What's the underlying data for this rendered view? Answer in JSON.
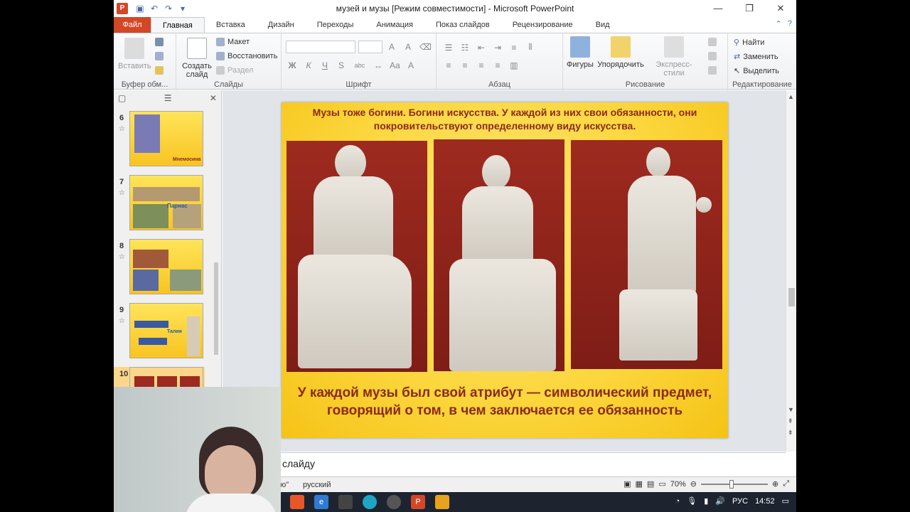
{
  "window": {
    "title": "музей и музы [Режим совместимости]  -  Microsoft PowerPoint",
    "app_icon": "P",
    "controls": [
      "minimize-icon",
      "restore-icon",
      "close-icon"
    ]
  },
  "tabs": [
    "Файл",
    "Главная",
    "Вставка",
    "Дизайн",
    "Переходы",
    "Анимация",
    "Показ слайдов",
    "Рецензирование",
    "Вид"
  ],
  "active_tab": "Главная",
  "ribbon": {
    "clipboard": {
      "paste": "Вставить",
      "label": "Буфер обм..."
    },
    "slides": {
      "new_slide": "Создать слайд",
      "layout": "Макет",
      "reset": "Восстановить",
      "section": "Раздел",
      "label": "Слайды"
    },
    "font": {
      "label": "Шрифт",
      "bold": "Ж",
      "italic": "К",
      "underline": "Ч",
      "strike": "S",
      "shadow": "abc"
    },
    "paragraph": {
      "label": "Абзац"
    },
    "drawing": {
      "shapes": "Фигуры",
      "arrange": "Упорядочить",
      "quick_styles": "Экспресс-стили",
      "label": "Рисование"
    },
    "editing": {
      "find": "Найти",
      "replace": "Заменить",
      "select": "Выделить",
      "label": "Редактирование"
    }
  },
  "slides_pane": {
    "thumbnails": [
      {
        "num": "6",
        "caption": "Мнемосина"
      },
      {
        "num": "7",
        "caption": "Парнас"
      },
      {
        "num": "8",
        "caption": ""
      },
      {
        "num": "9",
        "caption": "Талия"
      },
      {
        "num": "10",
        "caption": ""
      }
    ]
  },
  "slide": {
    "top_text": "Музы тоже богини. Богини искусства. У каждой из них свои обязанности, они покровительствуют определенному виду искусства.",
    "bottom_text": "У каждой музы был свой атрибут — символический предмет, говорящий о том, в чем заключается ее обязанность"
  },
  "notes": {
    "text": "слайду"
  },
  "status": {
    "left": "ю\"",
    "language": "русский",
    "zoom": "70%"
  },
  "taskbar": {
    "lang": "РУС",
    "time": "14:52"
  },
  "colors": {
    "accent": "#d24726",
    "slide_text": "#8b2a1a",
    "slide_bg": "#fbd53a"
  }
}
